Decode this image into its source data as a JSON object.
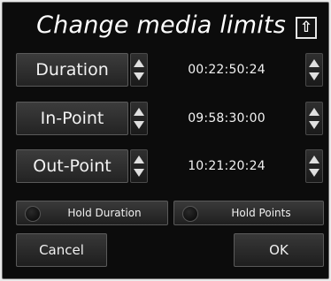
{
  "dialog": {
    "title": "Change media limits",
    "up_icon_glyph": "⇧"
  },
  "rows": [
    {
      "label": "Duration",
      "value": "00:22:50:24"
    },
    {
      "label": "In-Point",
      "value": "09:58:30:00"
    },
    {
      "label": "Out-Point",
      "value": "10:21:20:24"
    }
  ],
  "toggles": {
    "hold_duration": {
      "label": "Hold Duration",
      "on": false
    },
    "hold_points": {
      "label": "Hold Points",
      "on": false
    }
  },
  "buttons": {
    "cancel": "Cancel",
    "ok": "OK"
  }
}
